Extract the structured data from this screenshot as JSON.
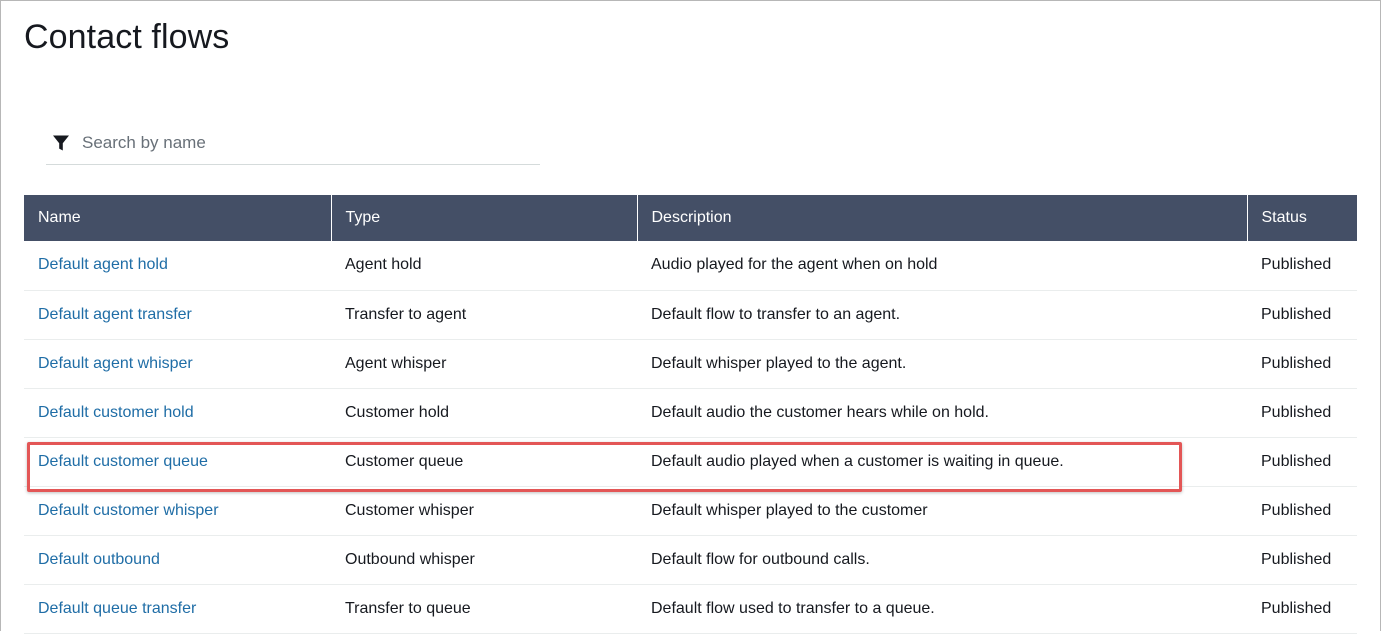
{
  "header": {
    "title": "Contact flows"
  },
  "search": {
    "placeholder": "Search by name",
    "value": ""
  },
  "icons": {
    "filter": "filter-icon"
  },
  "colors": {
    "header_bg": "#444f66",
    "link": "#1f6da6",
    "highlight": "#e35656"
  },
  "table": {
    "columns": [
      "Name",
      "Type",
      "Description",
      "Status"
    ],
    "rows": [
      {
        "name": "Default agent hold",
        "type": "Agent hold",
        "description": "Audio played for the agent when on hold",
        "status": "Published"
      },
      {
        "name": "Default agent transfer",
        "type": "Transfer to agent",
        "description": "Default flow to transfer to an agent.",
        "status": "Published"
      },
      {
        "name": "Default agent whisper",
        "type": "Agent whisper",
        "description": "Default whisper played to the agent.",
        "status": "Published"
      },
      {
        "name": "Default customer hold",
        "type": "Customer hold",
        "description": "Default audio the customer hears while on hold.",
        "status": "Published"
      },
      {
        "name": "Default customer queue",
        "type": "Customer queue",
        "description": "Default audio played when a customer is waiting in queue.",
        "status": "Published"
      },
      {
        "name": "Default customer whisper",
        "type": "Customer whisper",
        "description": "Default whisper played to the customer",
        "status": "Published"
      },
      {
        "name": "Default outbound",
        "type": "Outbound whisper",
        "description": "Default flow for outbound calls.",
        "status": "Published"
      },
      {
        "name": "Default queue transfer",
        "type": "Transfer to queue",
        "description": "Default flow used to transfer to a queue.",
        "status": "Published"
      }
    ]
  }
}
